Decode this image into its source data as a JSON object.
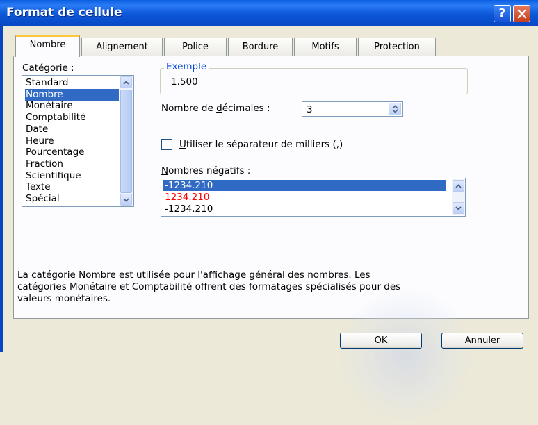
{
  "window": {
    "title": "Format de cellule"
  },
  "tabs": [
    {
      "label": "Nombre"
    },
    {
      "label": "Alignement"
    },
    {
      "label": "Police"
    },
    {
      "label": "Bordure"
    },
    {
      "label": "Motifs"
    },
    {
      "label": "Protection"
    }
  ],
  "category": {
    "label_prefix": "C",
    "label_rest": "atégorie :",
    "items": [
      "Standard",
      "Nombre",
      "Monétaire",
      "Comptabilité",
      "Date",
      "Heure",
      "Pourcentage",
      "Fraction",
      "Scientifique",
      "Texte",
      "Spécial"
    ],
    "selected": "Nombre"
  },
  "example": {
    "legend": "Exemple",
    "value": "1.500"
  },
  "decimals": {
    "label_a": "Nombre de ",
    "label_u": "d",
    "label_b": "écimales :",
    "value": "3"
  },
  "thousands": {
    "label_u": "U",
    "label_rest": "tiliser le séparateur de milliers (,)",
    "checked": false
  },
  "negative": {
    "label_u": "N",
    "label_rest": "ombres négatifs :",
    "items": [
      {
        "text": "-1234.210",
        "color": "#000000",
        "selected": true
      },
      {
        "text": "1234.210",
        "color": "#ff0000",
        "selected": false
      },
      {
        "text": "-1234.210",
        "color": "#000000",
        "selected": false
      }
    ]
  },
  "description": {
    "line1": "La catégorie Nombre est utilisée pour l'affichage général des nombres. Les",
    "line2": "catégories Monétaire et Comptabilité offrent des formatages spécialisés pour des",
    "line3": "valeurs monétaires."
  },
  "buttons": {
    "ok": "OK",
    "cancel": "Annuler"
  },
  "colors": {
    "titlebar": "#0b57d8",
    "selection": "#316ac5",
    "group_label": "#0046d5",
    "tab_highlight": "#ffc83c"
  }
}
